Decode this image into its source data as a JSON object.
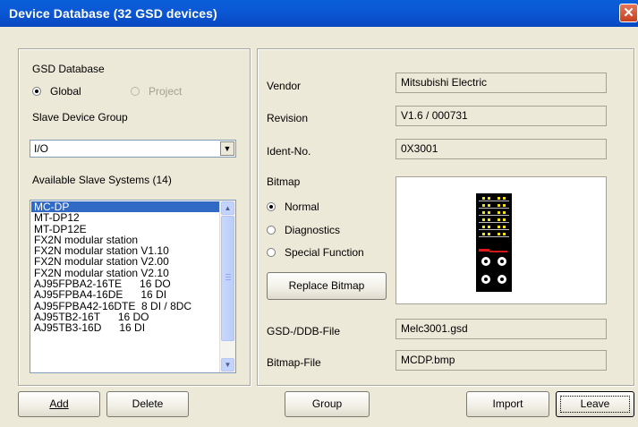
{
  "window": {
    "title": "Device Database (32 GSD devices)",
    "close_glyph": "✕"
  },
  "left_panel": {
    "gsd_database_label": "GSD Database",
    "radio_global_label": "Global",
    "radio_project_label": "Project",
    "selected_database": "Global",
    "slave_group_label": "Slave Device Group",
    "slave_group_value": "I/O",
    "available_label": "Available Slave Systems (14)",
    "items": [
      "MC-DP",
      "MT-DP12",
      "MT-DP12E",
      "FX2N modular station",
      "FX2N modular station V1.10",
      "FX2N modular station V2.00",
      "FX2N modular station V2.10",
      "AJ95FPBA2-16TE      16 DO",
      "AJ95FPBA4-16DE      16 DI",
      "AJ95FPBA42-16DTE  8 DI / 8DC",
      "AJ95TB2-16T      16 DO",
      "AJ95TB3-16D      16 DI"
    ],
    "selected_item": "MC-DP"
  },
  "right_panel": {
    "vendor_label": "Vendor",
    "vendor_value": "Mitsubishi Electric",
    "revision_label": "Revision",
    "revision_value": "V1.6 / 000731",
    "ident_label": "Ident-No.",
    "ident_value": "0X3001",
    "bitmap_label": "Bitmap",
    "radio_normal": "Normal",
    "radio_diagnostics": "Diagnostics",
    "radio_special": "Special Function",
    "selected_bitmap_mode": "Normal",
    "replace_bitmap_label": "Replace Bitmap",
    "gsd_file_label": "GSD-/DDB-File",
    "gsd_file_value": "Melc3001.gsd",
    "bitmap_file_label": "Bitmap-File",
    "bitmap_file_value": "MCDP.bmp"
  },
  "buttons": {
    "add": "Add",
    "delete": "Delete",
    "group": "Group",
    "import": "Import",
    "leave": "Leave"
  }
}
